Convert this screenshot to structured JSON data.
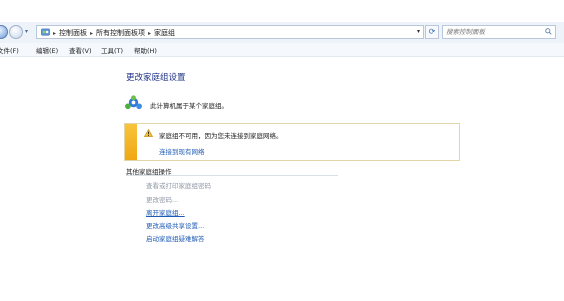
{
  "address_bar": {
    "breadcrumbs": [
      "控制面板",
      "所有控制面板项",
      "家庭组"
    ],
    "search_placeholder": "搜索控制面板"
  },
  "menu": {
    "items": [
      "文件(F)",
      "编辑(E)",
      "查看(V)",
      "工具(T)",
      "帮助(H)"
    ]
  },
  "main": {
    "title": "更改家庭组设置",
    "status_text": "此计算机属于某个家庭组。",
    "warning": {
      "message": "家庭组不可用，因为您未连接到家庭网络。",
      "link": "连接到现有网络"
    },
    "other_actions": {
      "heading": "其他家庭组操作",
      "items": [
        {
          "label": "查看或打印家庭组密码",
          "state": "disabled"
        },
        {
          "label": "更改密码...",
          "state": "disabled"
        },
        {
          "label": "离开家庭组...",
          "state": "hover"
        },
        {
          "label": "更改高级共享设置...",
          "state": "link"
        },
        {
          "label": "启动家庭组疑难解答",
          "state": "link"
        }
      ]
    }
  },
  "colors": {
    "title": "#1e3287",
    "link": "#1f5bb5",
    "disabled": "#8f99a6",
    "warning_bar": "#f4b526"
  },
  "icons": {
    "back": "back-arrow-icon",
    "forward": "forward-arrow-icon",
    "control_panel": "control-panel-icon",
    "refresh": "refresh-icon",
    "search": "search-icon",
    "homegroup": "homegroup-icon",
    "warning": "warning-icon"
  }
}
